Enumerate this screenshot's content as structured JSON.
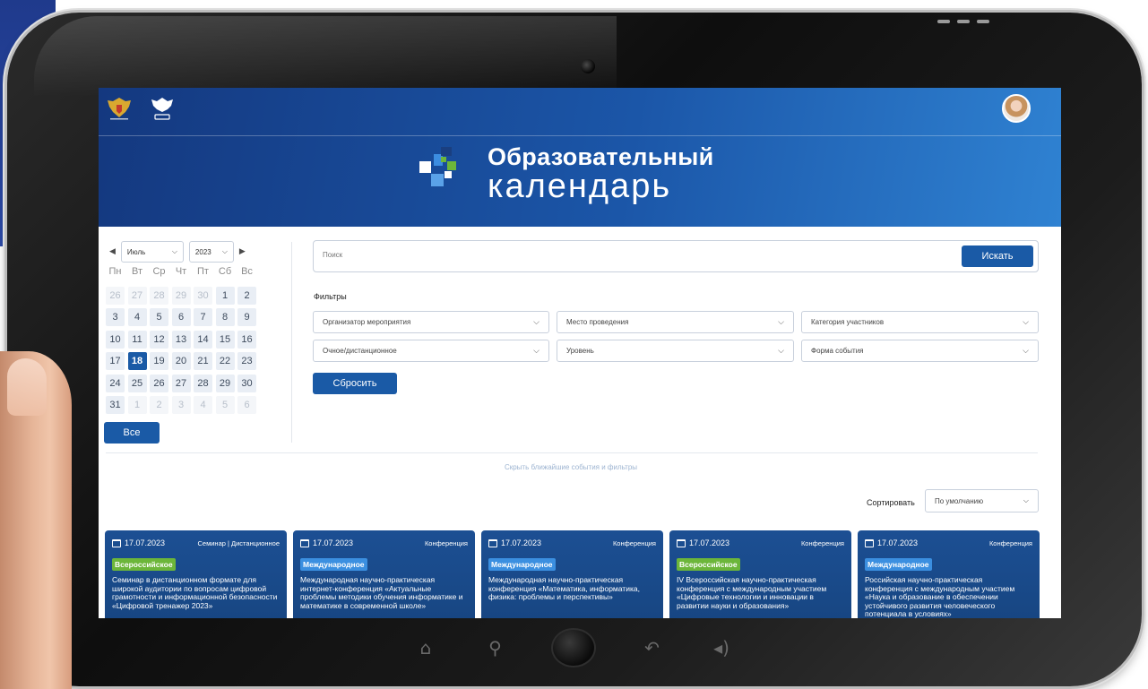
{
  "colors": {
    "primary": "#1a5aa6",
    "hero_start": "#14387f",
    "hero_end": "#2f82d2",
    "badge_green": "#6cb63a",
    "badge_blue": "#3b8fe0",
    "card_bg": "#1c4f93"
  },
  "header": {
    "brand_line1": "Образовательный",
    "brand_line2": "календарь"
  },
  "calendar": {
    "month": "Июль",
    "year": "2023",
    "prev_icon": "triangle-left-icon",
    "next_icon": "triangle-right-icon",
    "weekdays": [
      "Пн",
      "Вт",
      "Ср",
      "Чт",
      "Пт",
      "Сб",
      "Вс"
    ],
    "days": [
      {
        "d": "26",
        "muted": true
      },
      {
        "d": "27",
        "muted": true
      },
      {
        "d": "28",
        "muted": true
      },
      {
        "d": "29",
        "muted": true
      },
      {
        "d": "30",
        "muted": true
      },
      {
        "d": "1"
      },
      {
        "d": "2"
      },
      {
        "d": "3"
      },
      {
        "d": "4"
      },
      {
        "d": "5"
      },
      {
        "d": "6"
      },
      {
        "d": "7"
      },
      {
        "d": "8"
      },
      {
        "d": "9"
      },
      {
        "d": "10"
      },
      {
        "d": "11"
      },
      {
        "d": "12"
      },
      {
        "d": "13"
      },
      {
        "d": "14"
      },
      {
        "d": "15"
      },
      {
        "d": "16"
      },
      {
        "d": "17"
      },
      {
        "d": "18",
        "today": true
      },
      {
        "d": "19"
      },
      {
        "d": "20"
      },
      {
        "d": "21"
      },
      {
        "d": "22"
      },
      {
        "d": "23"
      },
      {
        "d": "24"
      },
      {
        "d": "25"
      },
      {
        "d": "26"
      },
      {
        "d": "27"
      },
      {
        "d": "28"
      },
      {
        "d": "29"
      },
      {
        "d": "30"
      },
      {
        "d": "31"
      },
      {
        "d": "1",
        "muted": true
      },
      {
        "d": "2",
        "muted": true
      },
      {
        "d": "3",
        "muted": true
      },
      {
        "d": "4",
        "muted": true
      },
      {
        "d": "5",
        "muted": true
      },
      {
        "d": "6",
        "muted": true
      }
    ],
    "all_button": "Все"
  },
  "search": {
    "placeholder": "Поиск",
    "button": "Искать"
  },
  "filters": {
    "label": "Фильтры",
    "organizer": "Организатор мероприятия",
    "place": "Место проведения",
    "category": "Категория участников",
    "mode": "Очное/дистанционное",
    "level": "Уровень",
    "form": "Форма события",
    "reset_button": "Сбросить"
  },
  "hide_link": "Скрыть ближайшие события и фильтры",
  "sort": {
    "label": "Сортировать",
    "value": "По умолчанию"
  },
  "cards": [
    {
      "date": "17.07.2023",
      "type": "Семинар | Дистанционное",
      "badge": "Всероссийское",
      "badge_color": "green",
      "title": "Семинар в дистанционном формате для широкой аудитории по вопросам цифровой грамотности и информационной безопасности «Цифровой тренажер 2023»"
    },
    {
      "date": "17.07.2023",
      "type": "Конференция",
      "badge": "Международное",
      "badge_color": "blue",
      "title": "Международная научно-практическая интернет-конференция «Актуальные проблемы методики обучения информатике и математике в современной школе»"
    },
    {
      "date": "17.07.2023",
      "type": "Конференция",
      "badge": "Международное",
      "badge_color": "blue",
      "title": "Международная научно-практическая конференция «Математика, информатика, физика: проблемы и перспективы»"
    },
    {
      "date": "17.07.2023",
      "type": "Конференция",
      "badge": "Всероссийское",
      "badge_color": "green",
      "title": "IV Всероссийская научно-практическая конференция с международным участием «Цифровые технологии и инновации в развитии науки и образования»"
    },
    {
      "date": "17.07.2023",
      "type": "Конференция",
      "badge": "Международное",
      "badge_color": "blue",
      "title": "Российская научно-практическая конференция с международным участием «Наука и образование в обеспечении устойчивого развития человеческого потенциала в условиях»"
    }
  ]
}
